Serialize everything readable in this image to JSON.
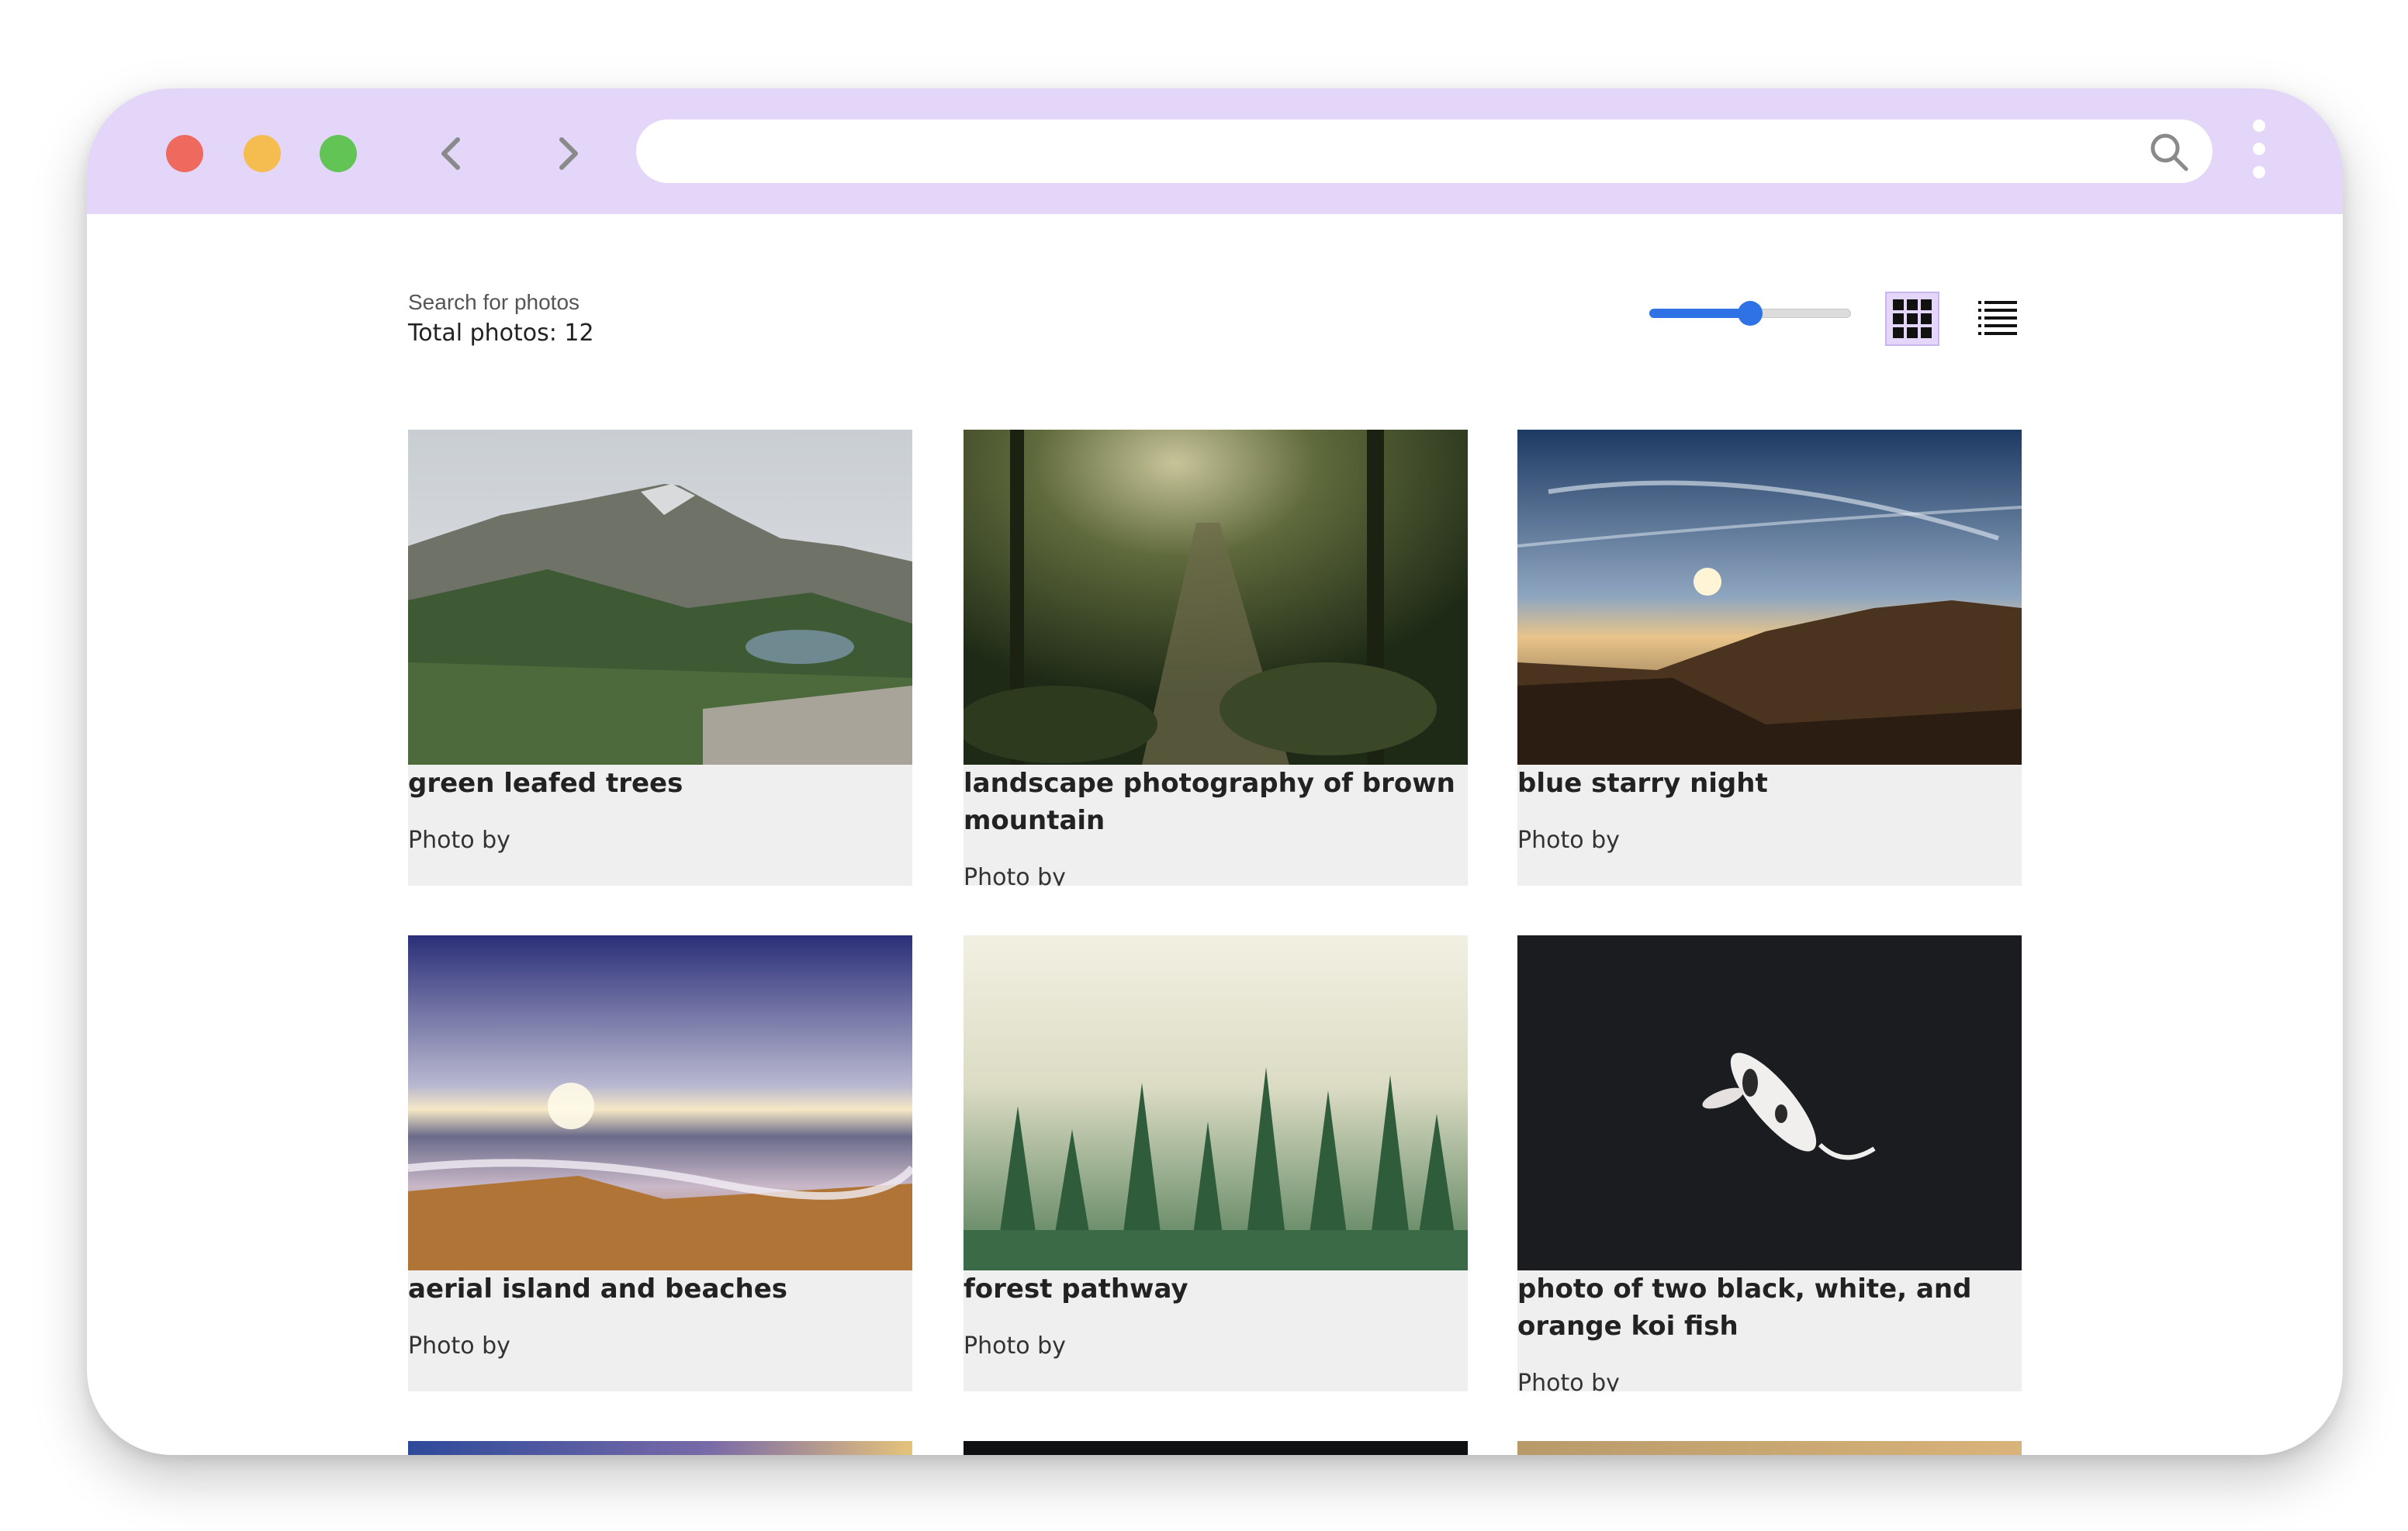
{
  "browser": {
    "address_value": "",
    "traffic_lights": {
      "close": "#ee6a5f",
      "minimize": "#f5bd4f",
      "zoom": "#61c454"
    },
    "accent": "#e3d6f8"
  },
  "header": {
    "subtitle": "Search for photos",
    "total": "Total photos: 12"
  },
  "controls": {
    "size_slider_value": 0.5,
    "active_view": "grid"
  },
  "photos": [
    {
      "title": "green leafed trees",
      "credit": "Photo by"
    },
    {
      "title": "landscape photography of brown mountain",
      "credit": "Photo by"
    },
    {
      "title": "blue starry night",
      "credit": "Photo by"
    },
    {
      "title": "aerial island and beaches",
      "credit": "Photo by"
    },
    {
      "title": "forest pathway",
      "credit": "Photo by"
    },
    {
      "title": "photo of two black, white, and orange koi fish",
      "credit": "Photo by"
    }
  ]
}
